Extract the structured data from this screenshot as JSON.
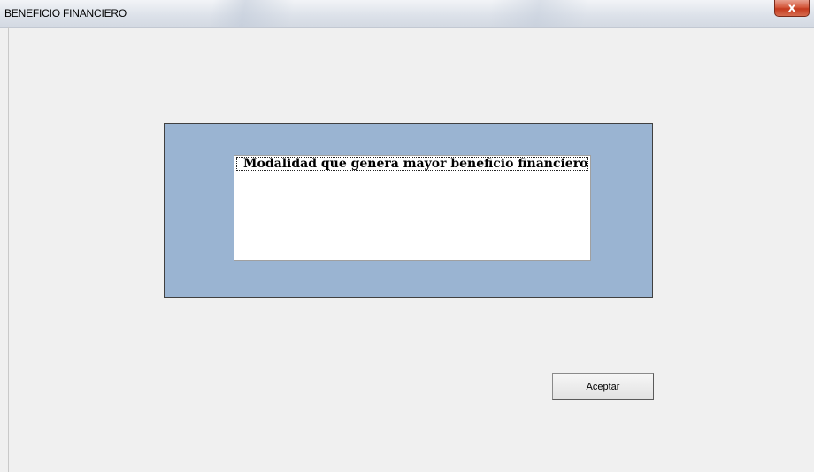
{
  "window": {
    "title": "BENEFICIO FINANCIERO",
    "close_glyph": "x",
    "close_icon": "close-icon"
  },
  "listbox": {
    "items": [
      "Modalidad que genera mayor beneficio financiero"
    ]
  },
  "buttons": {
    "accept_label": "Aceptar"
  },
  "colors": {
    "frame_background": "#9ab4d2",
    "window_background": "#f0f0f0",
    "close_button": "#c43a1f"
  }
}
